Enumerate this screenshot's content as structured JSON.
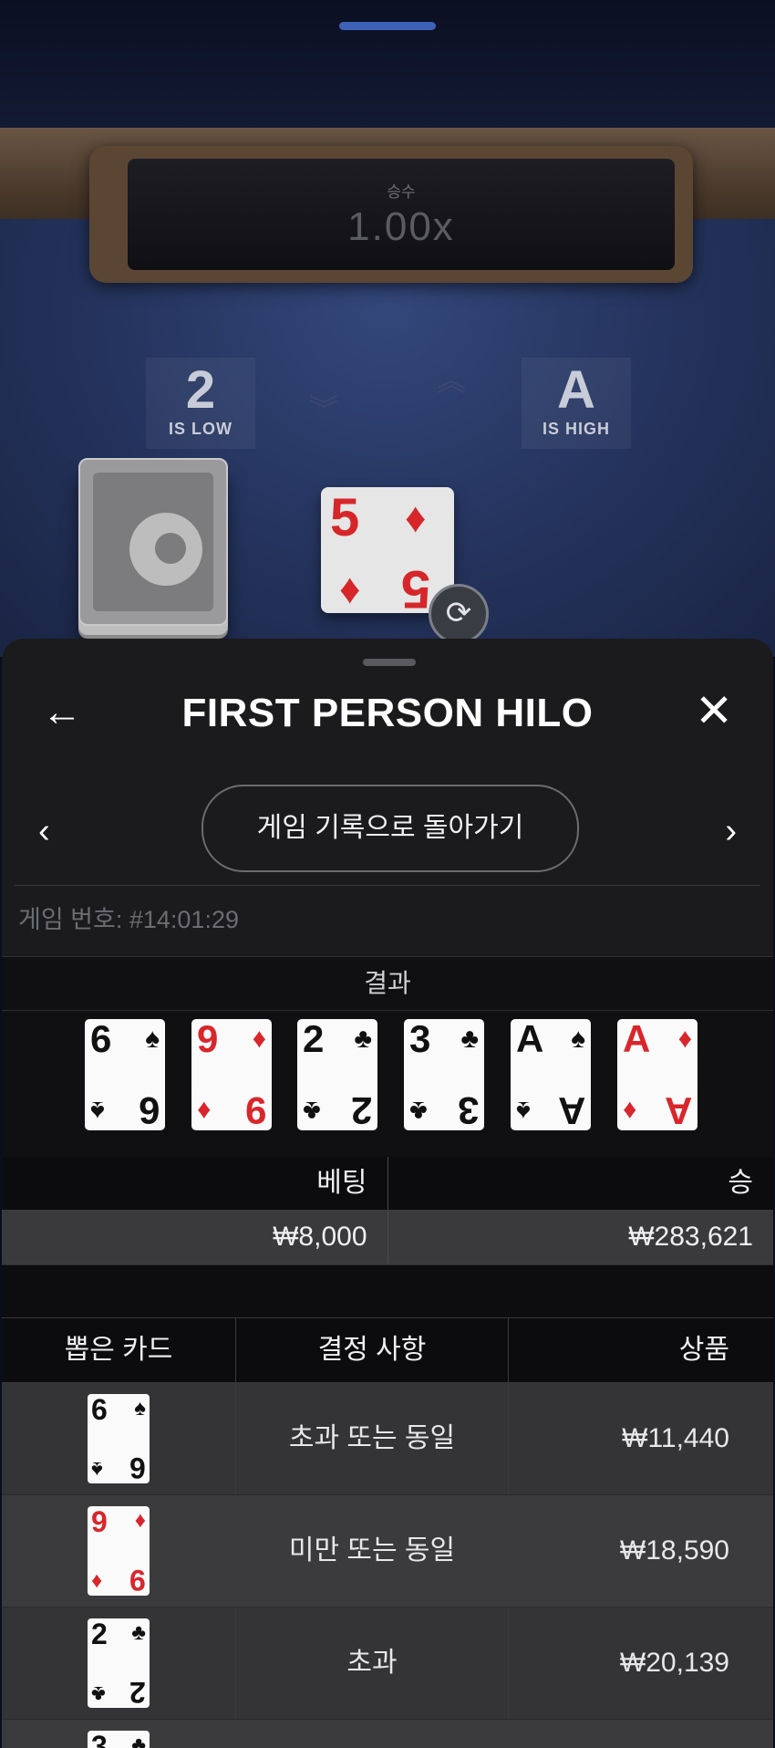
{
  "game": {
    "multiplier_label": "승수",
    "multiplier_value": "1.00x",
    "low": {
      "rank": "2",
      "caption": "IS LOW"
    },
    "high": {
      "rank": "A",
      "caption": "IS HIGH"
    },
    "current_card": {
      "rank": "5",
      "suit": "♦"
    },
    "swap_icon": "refresh-icon"
  },
  "sheet": {
    "title": "FIRST PERSON HILO",
    "back_icon": "←",
    "close_icon": "✕",
    "prev_icon": "‹",
    "next_icon": "›",
    "back_to_history": "게임 기록으로 돌아가기",
    "game_number": "게임 번호: #14:01:29",
    "result_title": "결과",
    "result_cards": [
      {
        "rank": "6",
        "suit": "♠",
        "color": "black"
      },
      {
        "rank": "9",
        "suit": "♦",
        "color": "red"
      },
      {
        "rank": "2",
        "suit": "♣",
        "color": "black"
      },
      {
        "rank": "3",
        "suit": "♣",
        "color": "black"
      },
      {
        "rank": "A",
        "suit": "♠",
        "color": "black"
      },
      {
        "rank": "A",
        "suit": "♦",
        "color": "red"
      }
    ],
    "bet_table": {
      "headers": [
        "베팅",
        "승"
      ],
      "values": [
        "₩8,000",
        "₩283,621"
      ]
    },
    "draw_table": {
      "headers": [
        "뽑은 카드",
        "결정 사항",
        "상품"
      ],
      "rows": [
        {
          "rank": "6",
          "suit": "♠",
          "color": "black",
          "decision": "초과 또는 동일",
          "prize": "₩11,440"
        },
        {
          "rank": "9",
          "suit": "♦",
          "color": "red",
          "decision": "미만 또는 동일",
          "prize": "₩18,590"
        },
        {
          "rank": "2",
          "suit": "♣",
          "color": "black",
          "decision": "초과",
          "prize": "₩20,139"
        },
        {
          "rank": "3",
          "suit": "♣",
          "color": "black",
          "decision": "",
          "prize": ""
        }
      ]
    }
  }
}
